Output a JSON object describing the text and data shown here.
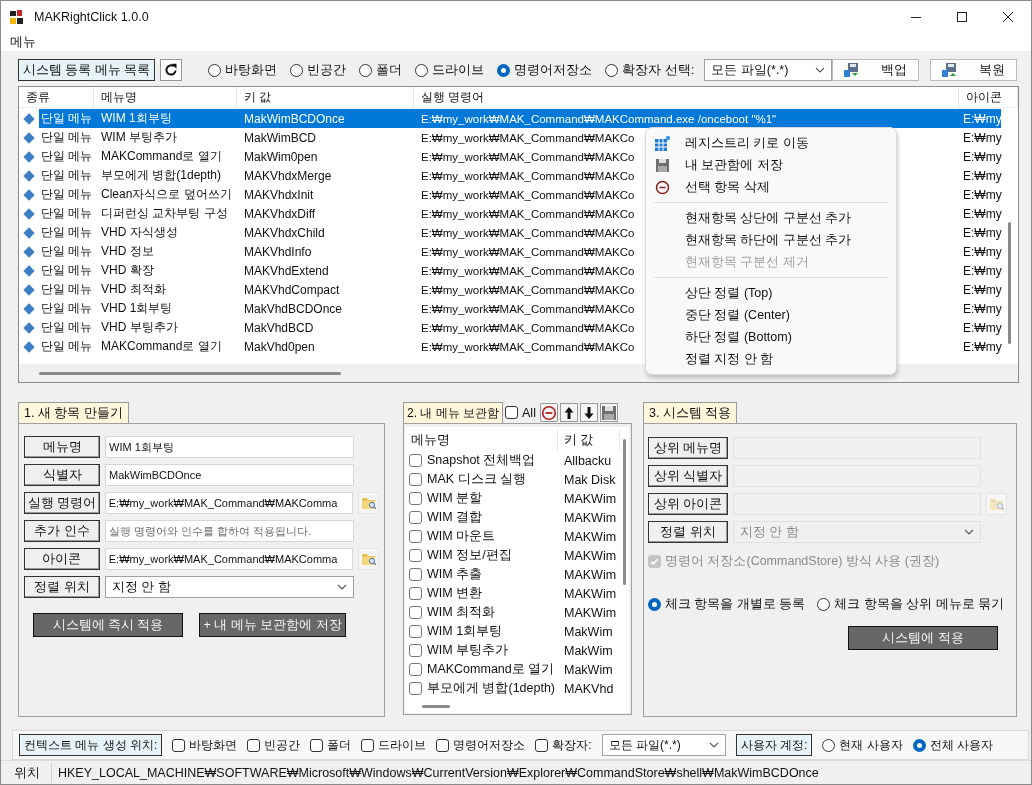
{
  "window": {
    "title": "MAKRightClick 1.0.0"
  },
  "menu_bar": [
    "메뉴"
  ],
  "toolbar": {
    "list_label": "시스템 등록 메뉴 목록",
    "scopes": [
      {
        "label": "바탕화면",
        "selected": false
      },
      {
        "label": "빈공간",
        "selected": false
      },
      {
        "label": "폴더",
        "selected": false
      },
      {
        "label": "드라이브",
        "selected": false
      },
      {
        "label": "명령어저장소",
        "selected": true
      },
      {
        "label": "확장자 선택:",
        "selected": false
      }
    ],
    "extension_filter": "모든 파일(*.*)",
    "buttons": [
      "백업",
      "복원"
    ]
  },
  "table": {
    "columns": [
      "종류",
      "메뉴명",
      "키 값",
      "실행 명령어",
      "아이콘"
    ],
    "rows": [
      {
        "type": "단일 메뉴",
        "name": "WIM 1회부팅",
        "key": "MakWimBCDOnce",
        "command": "E:₩my_work₩MAK_Command₩MAKCommand.exe /onceboot \"%1\"",
        "icon": "E:₩my",
        "selected": true
      },
      {
        "type": "단일 메뉴",
        "name": "WIM 부팅추가",
        "key": "MakWimBCD",
        "command": "E:₩my_work₩MAK_Command₩MAKCo",
        "icon": "E:₩my",
        "selected": false
      },
      {
        "type": "단일 메뉴",
        "name": "MAKCommand로 열기",
        "key": "MakWim0pen",
        "command": "E:₩my_work₩MAK_Command₩MAKCo",
        "icon": "E:₩my",
        "selected": false
      },
      {
        "type": "단일 메뉴",
        "name": "부모에게 병합(1depth)",
        "key": "MAKVhdxMerge",
        "command": "E:₩my_work₩MAK_Command₩MAKCo",
        "icon": "E:₩my",
        "selected": false
      },
      {
        "type": "단일 메뉴",
        "name": "Clean자식으로 덮어쓰기",
        "key": "MAKVhdxInit",
        "command": "E:₩my_work₩MAK_Command₩MAKCo",
        "icon": "E:₩my",
        "selected": false
      },
      {
        "type": "단일 메뉴",
        "name": "디퍼런싱 교차부팅 구성",
        "key": "MAKVhdxDiff",
        "command": "E:₩my_work₩MAK_Command₩MAKCo",
        "icon": "E:₩my",
        "selected": false
      },
      {
        "type": "단일 메뉴",
        "name": "VHD 자식생성",
        "key": "MAKVhdxChild",
        "command": "E:₩my_work₩MAK_Command₩MAKCo",
        "icon": "E:₩my",
        "selected": false
      },
      {
        "type": "단일 메뉴",
        "name": "VHD 정보",
        "key": "MAKVhdInfo",
        "command": "E:₩my_work₩MAK_Command₩MAKCo",
        "icon": "E:₩my",
        "selected": false
      },
      {
        "type": "단일 메뉴",
        "name": "VHD 확장",
        "key": "MAKVhdExtend",
        "command": "E:₩my_work₩MAK_Command₩MAKCo",
        "icon": "E:₩my",
        "selected": false
      },
      {
        "type": "단일 메뉴",
        "name": "VHD 최적화",
        "key": "MAKVhdCompact",
        "command": "E:₩my_work₩MAK_Command₩MAKCo",
        "icon": "E:₩my",
        "selected": false
      },
      {
        "type": "단일 메뉴",
        "name": "VHD 1회부팅",
        "key": "MakVhdBCDOnce",
        "command": "E:₩my_work₩MAK_Command₩MAKCo",
        "icon": "E:₩my",
        "selected": false
      },
      {
        "type": "단일 메뉴",
        "name": "VHD 부팅추가",
        "key": "MakVhdBCD",
        "command": "E:₩my_work₩MAK_Command₩MAKCo",
        "icon": "E:₩my",
        "selected": false
      },
      {
        "type": "단일 메뉴",
        "name": "MAKCommand로 열기",
        "key": "MakVhd0pen",
        "command": "E:₩my_work₩MAK_Command₩MAKCo",
        "icon": "E:₩my",
        "selected": false
      }
    ]
  },
  "context_menu": {
    "groups": [
      [
        {
          "label": "레지스트리 키로 이동",
          "disabled": false
        },
        {
          "label": "내 보관함에 저장",
          "disabled": false
        },
        {
          "label": "선택 항목 삭제",
          "disabled": false
        }
      ],
      [
        {
          "label": "현재항목 상단에 구분선 추가",
          "disabled": false
        },
        {
          "label": "현재항목 하단에 구분선 추가",
          "disabled": false
        },
        {
          "label": "현재항목 구분선 제거",
          "disabled": true
        }
      ],
      [
        {
          "label": "상단 정렬 (Top)",
          "disabled": false
        },
        {
          "label": "중단 정렬 (Center)",
          "disabled": false
        },
        {
          "label": "하단 정렬 (Bottom)",
          "disabled": false
        },
        {
          "label": "정렬 지정 안 함",
          "disabled": false
        }
      ]
    ]
  },
  "new_item": {
    "title": "1. 새 항목 만들기",
    "fields": [
      {
        "label": "메뉴명",
        "kind": "text",
        "value": "WIM 1회부팅",
        "disabled": false
      },
      {
        "label": "식별자",
        "kind": "text",
        "value": "MakWimBCDOnce",
        "disabled": false
      },
      {
        "label": "실행 명령어",
        "kind": "browse",
        "value": "E:₩my_work₩MAK_Command₩MAKComma",
        "disabled": false
      },
      {
        "label": "추가 인수",
        "kind": "text",
        "placeholder": "실행 명령어와 인수를 합하여 적용됩니다.",
        "disabled": false
      },
      {
        "label": "아이콘",
        "kind": "browse",
        "value": "E:₩my_work₩MAK_Command₩MAKComma",
        "disabled": false
      },
      {
        "label": "정렬 위치",
        "kind": "dropdown",
        "value": "지정 안 함",
        "disabled": false
      }
    ],
    "buttons": [
      "시스템에 즉시 적용",
      "+ 내 메뉴 보관함에 저장"
    ]
  },
  "store": {
    "title": "2. 내 메뉴 보관함",
    "select_all": {
      "label": "All",
      "checked": false
    },
    "columns": [
      "메뉴명",
      "키 값"
    ],
    "items": [
      {
        "name": "Snapshot 전체백업",
        "key": "Allbacku",
        "checked": false
      },
      {
        "name": "MAK 디스크 실행",
        "key": "Mak Disk",
        "checked": false
      },
      {
        "name": "WIM 분할",
        "key": "MAKWim",
        "checked": false
      },
      {
        "name": "WIM 결합",
        "key": "MAKWim",
        "checked": false
      },
      {
        "name": "WIM 마운트",
        "key": "MAKWim",
        "checked": false
      },
      {
        "name": "WIM 정보/편집",
        "key": "MAKWim",
        "checked": false
      },
      {
        "name": "WIM 추출",
        "key": "MAKWim",
        "checked": false
      },
      {
        "name": "WIM 변환",
        "key": "MAKWim",
        "checked": false
      },
      {
        "name": "WIM 최적화",
        "key": "MAKWim",
        "checked": false
      },
      {
        "name": "WIM 1회부팅",
        "key": "MakWim",
        "checked": false
      },
      {
        "name": "WIM 부팅추가",
        "key": "MakWim",
        "checked": false
      },
      {
        "name": "MAKCommand로 열기",
        "key": "MakWim",
        "checked": false
      },
      {
        "name": "부모에게 병합(1depth)",
        "key": "MAKVhd",
        "checked": false
      }
    ]
  },
  "apply": {
    "title": "3. 시스템 적용",
    "fields": [
      {
        "label": "상위 메뉴명",
        "kind": "text",
        "disabled": true
      },
      {
        "label": "상위 식별자",
        "kind": "text",
        "disabled": true
      },
      {
        "label": "상위 아이콘",
        "kind": "browse",
        "disabled": true
      },
      {
        "label": "정렬 위치",
        "kind": "dropdown",
        "value": "지정 안 함",
        "disabled": true
      }
    ],
    "command_store": {
      "label": "명령어 저장소(CommandStore) 방식 사용 (권장)",
      "checked": true,
      "disabled": true
    },
    "modes": [
      {
        "label": "체크 항목을 개별로 등록",
        "selected": true
      },
      {
        "label": "체크 항목을 상위 메뉴로 묶기",
        "selected": false
      }
    ],
    "button": "시스템에 적용"
  },
  "bottom_bar": {
    "label": "컨텍스트 메뉴 생성 위치:",
    "targets": [
      {
        "label": "바탕화면",
        "checked": false
      },
      {
        "label": "빈공간",
        "checked": false
      },
      {
        "label": "폴더",
        "checked": false
      },
      {
        "label": "드라이브",
        "checked": false
      },
      {
        "label": "명령어저장소",
        "checked": false
      },
      {
        "label": "확장자:",
        "checked": false
      }
    ],
    "extension_filter": "모든 파일(*.*)",
    "account_label": "사용자 계정:",
    "accounts": [
      {
        "label": "현재 사용자",
        "selected": false
      },
      {
        "label": "전체 사용자",
        "selected": true
      }
    ]
  },
  "status_bar": {
    "label": "위치",
    "path": "HKEY_LOCAL_MACHINE₩SOFTWARE₩Microsoft₩Windows₩CurrentVersion₩Explorer₩CommandStore₩shell₩MakWimBCDOnce"
  }
}
